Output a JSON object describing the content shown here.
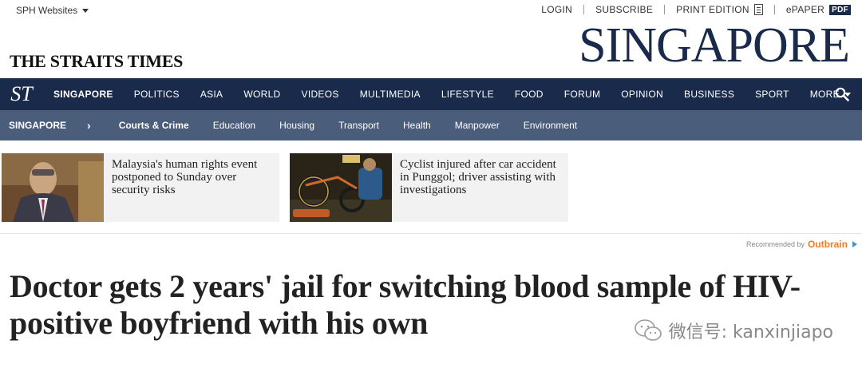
{
  "topbar": {
    "sph_label": "SPH Websites",
    "login": "LOGIN",
    "subscribe": "SUBSCRIBE",
    "print_edition": "PRINT EDITION",
    "epaper": "ePAPER",
    "pdf_badge": "PDF"
  },
  "masthead": {
    "title": "THE STRAITS TIMES",
    "section": "SINGAPORE"
  },
  "nav": {
    "logo": "ST",
    "items": [
      "SINGAPORE",
      "POLITICS",
      "ASIA",
      "WORLD",
      "VIDEOS",
      "MULTIMEDIA",
      "LIFESTYLE",
      "FOOD",
      "FORUM",
      "OPINION",
      "BUSINESS",
      "SPORT",
      "MORE"
    ],
    "active": "SINGAPORE"
  },
  "subnav": {
    "crumb": "SINGAPORE",
    "chevron": "›",
    "items": [
      "Courts & Crime",
      "Education",
      "Housing",
      "Transport",
      "Health",
      "Manpower",
      "Environment"
    ],
    "active": "Courts & Crime"
  },
  "cards": [
    {
      "title": "Malaysia's human rights event postponed to Sunday over security risks"
    },
    {
      "title": "Cyclist injured after car accident in Punggol; driver assisting with investigations"
    }
  ],
  "outbrain": {
    "recommended": "Recommended by",
    "brand": "Outbrain"
  },
  "article": {
    "headline": "Doctor gets 2 years' jail for switching blood sample of HIV-positive boyfriend with his own"
  },
  "watermark": {
    "text": "微信号: kanxinjiapo"
  },
  "colors": {
    "nav_bg": "#1a2a4a",
    "subnav_bg": "#4a5d7a",
    "outbrain_orange": "#f47b20"
  }
}
